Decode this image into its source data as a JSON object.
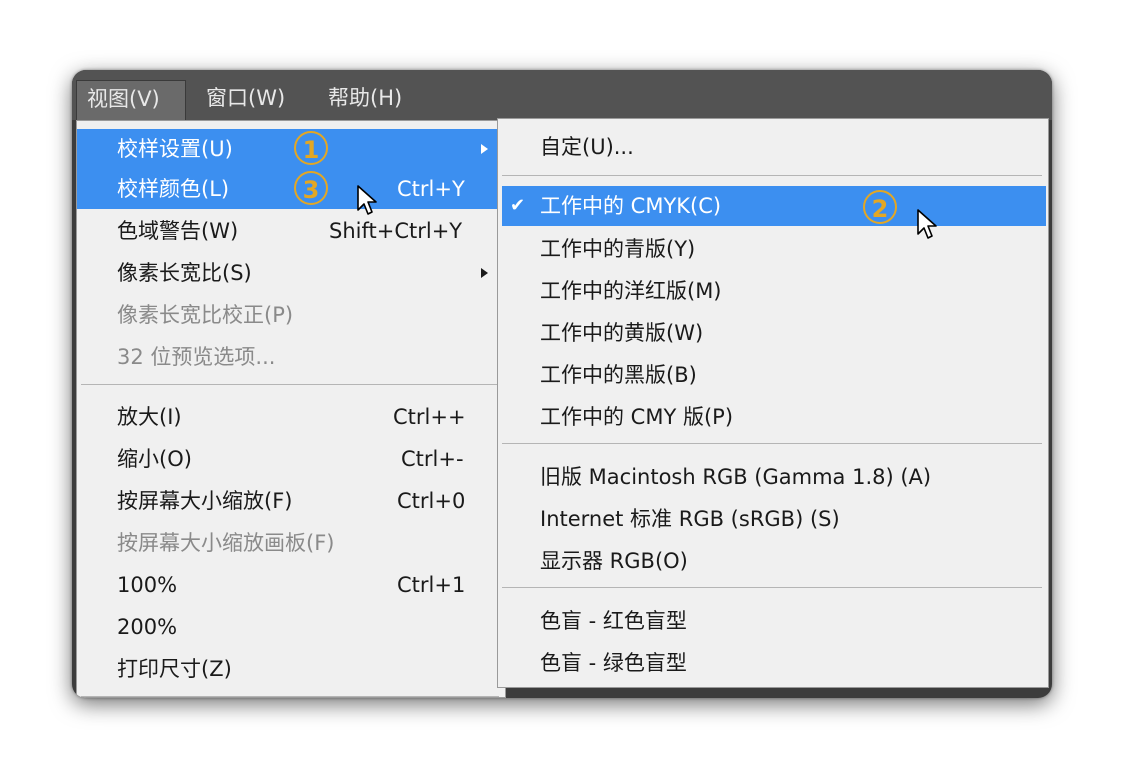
{
  "menubar": {
    "items": [
      {
        "label": "视图(V)",
        "active": true
      },
      {
        "label": "窗口(W)",
        "active": false
      },
      {
        "label": "帮助(H)",
        "active": false
      }
    ]
  },
  "view_menu": {
    "items": [
      {
        "label": "校样设置(U)",
        "shortcut": "",
        "submenu": true,
        "highlighted": true
      },
      {
        "label": "校样颜色(L)",
        "shortcut": "Ctrl+Y",
        "highlighted": true
      },
      {
        "label": "色域警告(W)",
        "shortcut": "Shift+Ctrl+Y"
      },
      {
        "label": "像素长宽比(S)",
        "shortcut": "",
        "submenu": true
      },
      {
        "label": "像素长宽比校正(P)",
        "shortcut": "",
        "disabled": true
      },
      {
        "label": "32 位预览选项...",
        "shortcut": "",
        "disabled": true
      },
      {
        "label": "放大(I)",
        "shortcut": "Ctrl++"
      },
      {
        "label": "缩小(O)",
        "shortcut": "Ctrl+-"
      },
      {
        "label": "按屏幕大小缩放(F)",
        "shortcut": "Ctrl+0"
      },
      {
        "label": "按屏幕大小缩放画板(F)",
        "shortcut": "",
        "disabled": true
      },
      {
        "label": "100%",
        "shortcut": "Ctrl+1"
      },
      {
        "label": "200%",
        "shortcut": ""
      },
      {
        "label": "打印尺寸(Z)",
        "shortcut": ""
      }
    ]
  },
  "proof_submenu": {
    "items": [
      {
        "label": "自定(U)..."
      },
      {
        "label": "工作中的 CMYK(C)",
        "checked": true,
        "highlighted": true
      },
      {
        "label": "工作中的青版(Y)"
      },
      {
        "label": "工作中的洋红版(M)"
      },
      {
        "label": "工作中的黄版(W)"
      },
      {
        "label": "工作中的黑版(B)"
      },
      {
        "label": "工作中的 CMY 版(P)"
      },
      {
        "label": "旧版 Macintosh RGB (Gamma 1.8) (A)"
      },
      {
        "label": "Internet 标准 RGB (sRGB) (S)"
      },
      {
        "label": "显示器 RGB(O)"
      },
      {
        "label": "色盲 - 红色盲型"
      },
      {
        "label": "色盲 - 绿色盲型"
      }
    ]
  },
  "badges": {
    "one": "1",
    "two": "2",
    "three": "3"
  },
  "check_mark": "✔",
  "colors": {
    "highlight": "#3c8ff0",
    "badge": "#e3a724",
    "menubar": "#535353"
  }
}
